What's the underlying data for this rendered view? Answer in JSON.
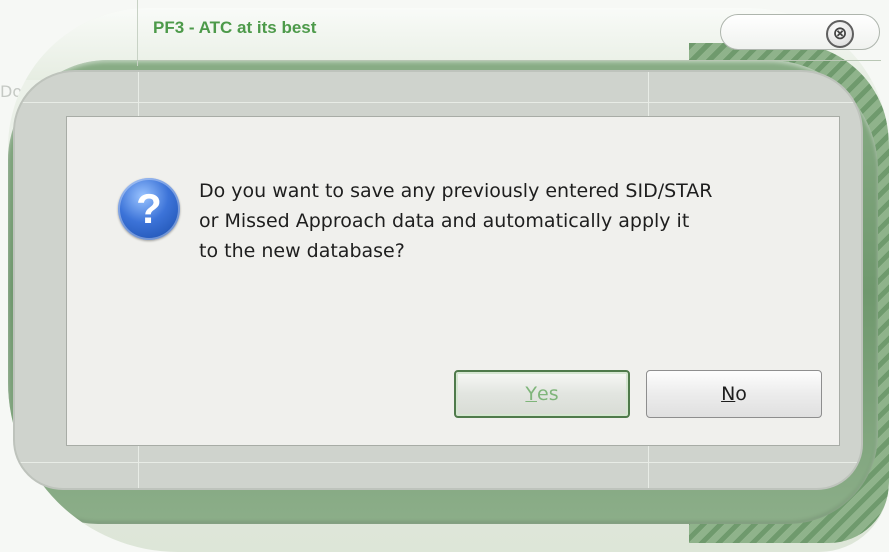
{
  "window": {
    "title": "PF3 - ATC at its best",
    "close_glyph": "⊗",
    "close_icon": "close-icon"
  },
  "background": {
    "hint_text": "Do"
  },
  "dialog": {
    "icon": "question-icon",
    "icon_glyph": "?",
    "message_lines": [
      "Do you want to save any previously entered SID/STAR",
      "or Missed Approach data and automatically apply it",
      "to the new database?"
    ],
    "buttons": {
      "yes": {
        "mnemonic": "Y",
        "rest": "es",
        "label": "Yes"
      },
      "no": {
        "mnemonic": "N",
        "rest": "o",
        "label": "No"
      }
    }
  },
  "colors": {
    "title_text": "#4d9a4a",
    "frame_green": "#6f986d",
    "panel_bg": "#f0f0ed",
    "yes_text": "#7fb57a"
  }
}
